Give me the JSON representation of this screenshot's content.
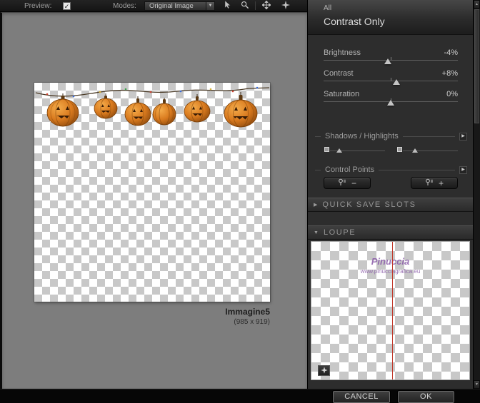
{
  "toolbar": {
    "preview_label": "Preview:",
    "modes_label": "Modes:",
    "mode_value": "Original Image"
  },
  "canvas": {
    "image_name": "Immagine5",
    "image_dimensions": "(985 x 919)"
  },
  "panel": {
    "scope_label": "All",
    "title": "Contrast Only",
    "sliders": [
      {
        "label": "Brightness",
        "value": "-4%"
      },
      {
        "label": "Contrast",
        "value": "+8%"
      },
      {
        "label": "Saturation",
        "value": "0%"
      }
    ],
    "shadows_highlights": {
      "label": "Shadows / Highlights"
    },
    "control_points": {
      "label": "Control Points",
      "remove_label": "−",
      "add_label": "+"
    },
    "quick_save": {
      "label": "QUICK SAVE SLOTS"
    },
    "loupe": {
      "label": "LOUPE",
      "watermark_line1": "Pinuccia",
      "watermark_line2": "www.pinucciagrafica.eu"
    }
  },
  "footer": {
    "cancel_label": "CANCEL",
    "ok_label": "OK"
  },
  "icons": {
    "checkbox_check": "✓",
    "dropdown_arrow": "▼",
    "collapsed_arrow": "▶",
    "expanded_arrow": "▼",
    "detail_arrow": "▶",
    "scroll_up_arrow": "▲",
    "scroll_down_arrow": "▼"
  },
  "colors": {
    "accent_red_line": "#c0392b",
    "watermark_purple": "#8a5aa8",
    "pumpkin_orange": "#d97a1e"
  }
}
